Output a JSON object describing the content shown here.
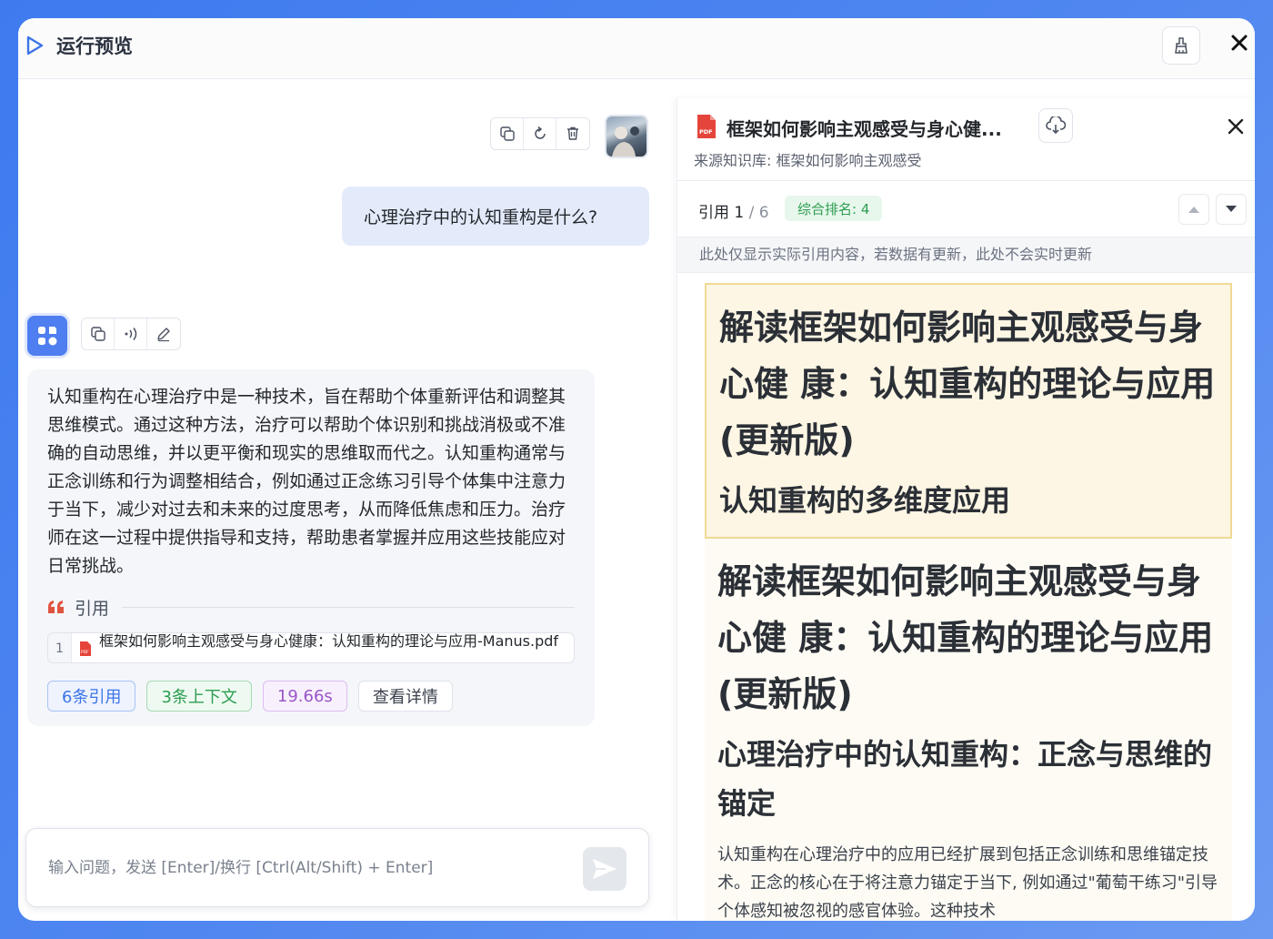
{
  "header": {
    "title": "运行预览"
  },
  "chat": {
    "user_question": "心理治疗中的认知重构是什么?",
    "ai_answer": "认知重构在心理治疗中是一种技术，旨在帮助个体重新评估和调整其思维模式。通过这种方法，治疗可以帮助个体识别和挑战消极或不准确的自动思维，并以更平衡和现实的思维取而代之。认知重构通常与正念训练和行为调整相结合，例如通过正念练习引导个体集中注意力于当下，减少对过去和未来的过度思考，从而降低焦虑和压力。治疗师在这一过程中提供指导和支持，帮助患者掌握并应用这些技能应对日常挑战。",
    "quote_label": "引用",
    "citation": {
      "index": "1",
      "file": "框架如何影响主观感受与身心健康：认知重构的理论与应用-Manus.pdf"
    },
    "tags": {
      "citations": "6条引用",
      "context": "3条上下文",
      "time": "19.66s",
      "details": "查看详情"
    },
    "input_placeholder": "输入问题，发送 [Enter]/换行 [Ctrl(Alt/Shift) + Enter]"
  },
  "panel": {
    "title": "框架如何影响主观感受与身心健...",
    "source": "来源知识库: 框架如何影响主观感受",
    "nav_prefix": "引用 1",
    "nav_total": " / 6",
    "rank": "综合排名: 4",
    "notice": "此处仅显示实际引用内容，若数据有更新，此处不会实时更新",
    "blocks": [
      {
        "title": "解读框架如何影响主观感受与身心健 康：认知重构的理论与应用(更新版)",
        "subtitle": "认知重构的多维度应用"
      },
      {
        "title": "解读框架如何影响主观感受与身心健 康：认知重构的理论与应用(更新版)",
        "subtitle": "心理治疗中的认知重构：正念与思维的锚定",
        "body": "认知重构在心理治疗中的应用已经扩展到包括正念训练和思维锚定技术。正念的核心在于将注意力锚定于当下, 例如通过\"葡萄干练习\"引导个体感知被忽视的感官体验。这种技术"
      }
    ]
  }
}
